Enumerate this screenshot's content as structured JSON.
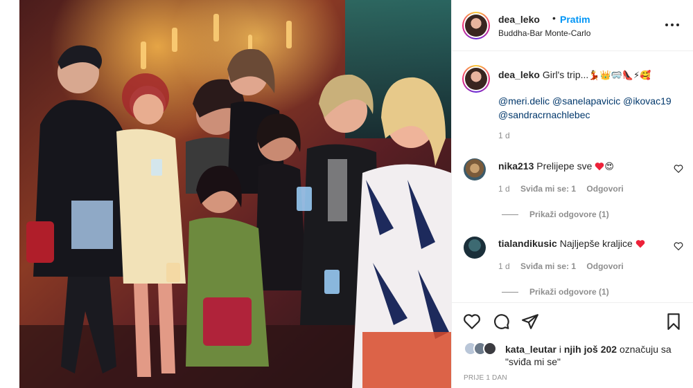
{
  "post": {
    "username": "dea_leko",
    "dot": "•",
    "follow_label": "Pratim",
    "location": "Buddha-Bar Monte-Carlo"
  },
  "caption": {
    "username": "dea_leko",
    "text": "Girl's trip...",
    "emojis": "💃👑🥽👠⚡🥰",
    "mentions": [
      "@meri.delic",
      "@sanelapavicic",
      "@ikovac19",
      "@sandracrnachlebec"
    ],
    "time": "1 d"
  },
  "comments": [
    {
      "username": "nika213",
      "text": "Prelijepe sve",
      "emojis": "😍",
      "time": "1 d",
      "likes": "Sviđa mi se: 1",
      "reply_label": "Odgovori",
      "view_replies": "Prikaži odgovore (1)"
    },
    {
      "username": "tialandikusic",
      "text": "Najljepše kraljice",
      "time": "1 d",
      "likes": "Sviđa mi se: 1",
      "reply_label": "Odgovori",
      "view_replies": "Prikaži odgovore (1)"
    }
  ],
  "likes": {
    "user": "kata_leutar",
    "connector": "i",
    "others": "njih još 202",
    "suffix": "označuju sa \"sviđa mi se\""
  },
  "posted_ago": "PRIJE 1 DAN",
  "colors": {
    "link": "#00376b",
    "follow": "#0095f6",
    "muted": "#8e8e8e",
    "heart": "#ed4956"
  },
  "icons": [
    "more-options-icon",
    "heart-icon",
    "comment-icon",
    "share-icon",
    "bookmark-icon"
  ]
}
